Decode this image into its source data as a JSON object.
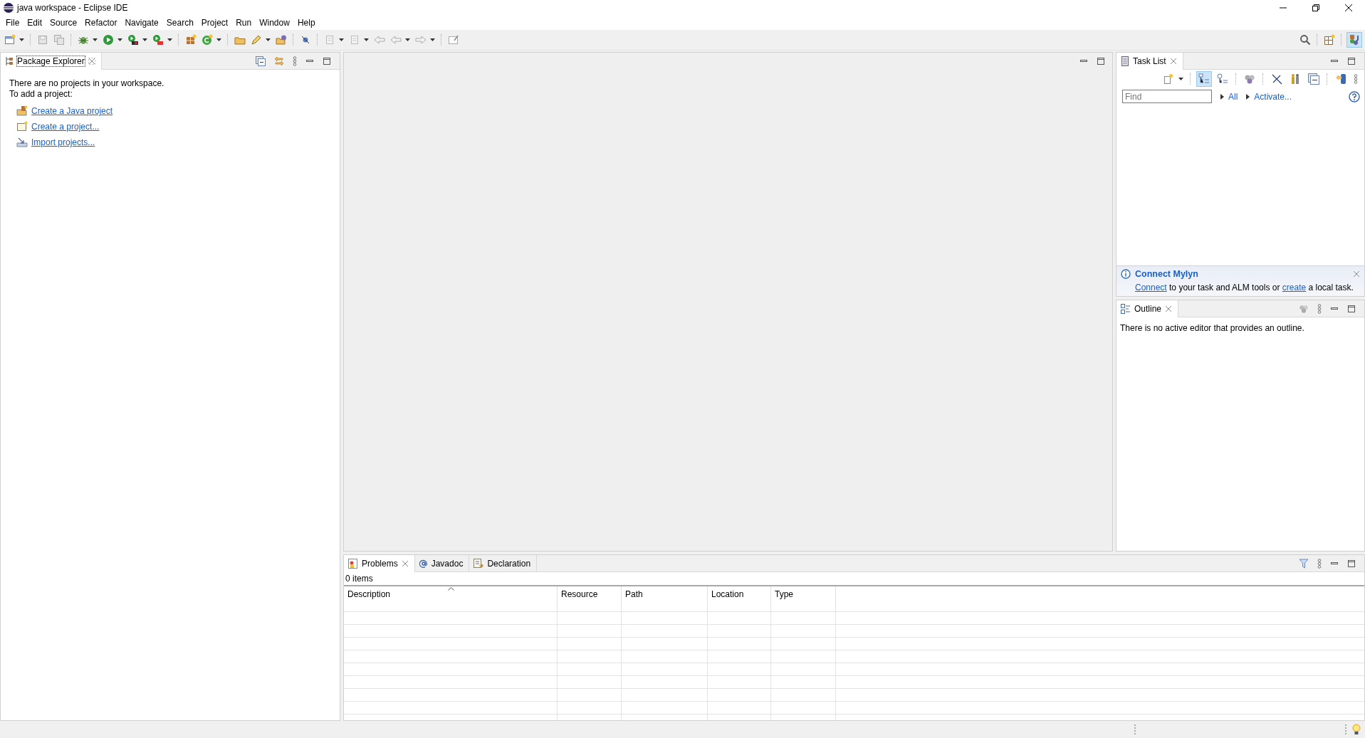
{
  "window": {
    "title": "java workspace - Eclipse IDE"
  },
  "menu": [
    "File",
    "Edit",
    "Source",
    "Refactor",
    "Navigate",
    "Search",
    "Project",
    "Run",
    "Window",
    "Help"
  ],
  "package_explorer": {
    "tab": {
      "label": "Package Explorer",
      "selected": true
    },
    "message": [
      "There are no projects in your workspace.",
      "To add a project:"
    ],
    "links": [
      {
        "kind": "java",
        "label": "Create a Java project"
      },
      {
        "kind": "project",
        "label": "Create a project..."
      },
      {
        "kind": "import",
        "label": "Import projects..."
      }
    ]
  },
  "task_list": {
    "tab": "Task List",
    "find": {
      "placeholder": "Find"
    },
    "filters": [
      "All",
      "Activate..."
    ],
    "notice": {
      "title": "Connect Mylyn",
      "parts": [
        {
          "kind": "link",
          "text": "Connect"
        },
        {
          "kind": "text",
          "text": " to your task and ALM tools or "
        },
        {
          "kind": "link",
          "text": "create"
        },
        {
          "kind": "text",
          "text": " a local task."
        }
      ]
    }
  },
  "outline": {
    "tab": "Outline",
    "message": "There is no active editor that provides an outline."
  },
  "bottom": {
    "tabs": [
      {
        "kind": "problems",
        "label": "Problems",
        "selected": true
      },
      {
        "kind": "javadoc",
        "label": "Javadoc",
        "selected": false
      },
      {
        "kind": "declaration",
        "label": "Declaration",
        "selected": false
      }
    ],
    "count": "0 items",
    "columns": [
      {
        "label": "Description",
        "sorted": true
      },
      {
        "label": "Resource",
        "sorted": false
      },
      {
        "label": "Path",
        "sorted": false
      },
      {
        "label": "Location",
        "sorted": false
      },
      {
        "label": "Type",
        "sorted": false
      }
    ]
  }
}
